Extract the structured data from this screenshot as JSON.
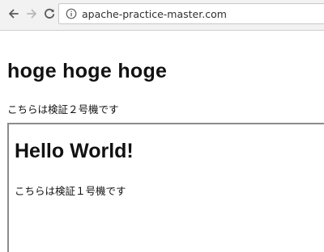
{
  "browser": {
    "url": "apache-practice-master.com"
  },
  "page": {
    "heading": "hoge hoge hoge",
    "text": "こちらは検証２号機です"
  },
  "iframe": {
    "heading": "Hello World!",
    "text": "こちらは検証１号機です"
  },
  "icons": {
    "back": "arrow-left-icon",
    "forward": "arrow-right-icon",
    "reload": "reload-icon",
    "info": "info-icon"
  }
}
